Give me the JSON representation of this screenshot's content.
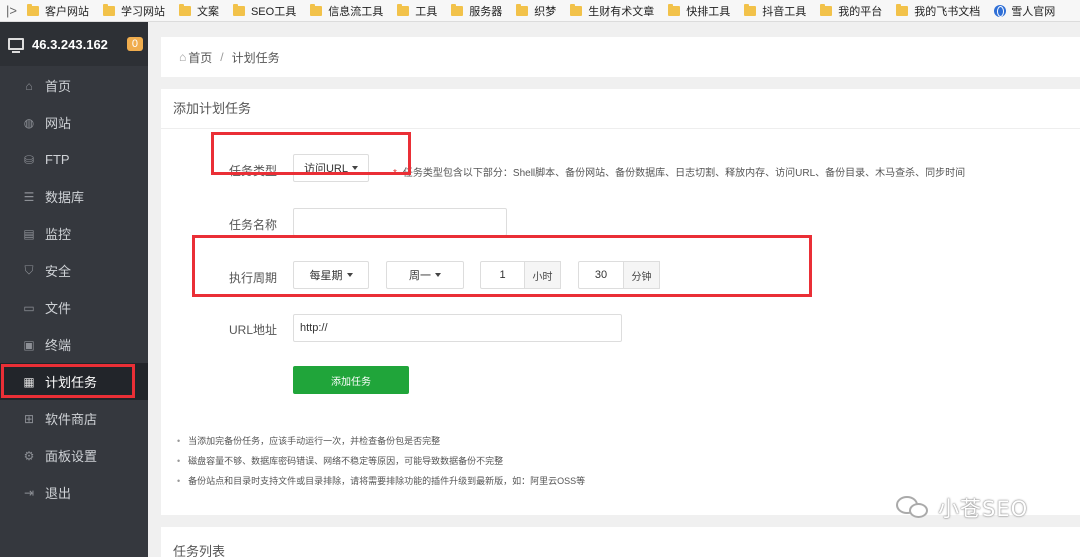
{
  "bookmarks": [
    {
      "label": "客户网站",
      "icon": "folder-icon"
    },
    {
      "label": "学习网站",
      "icon": "folder-icon"
    },
    {
      "label": "文案",
      "icon": "folder-icon"
    },
    {
      "label": "SEO工具",
      "icon": "folder-icon"
    },
    {
      "label": "信息流工具",
      "icon": "folder-icon"
    },
    {
      "label": "工具",
      "icon": "folder-icon"
    },
    {
      "label": "服务器",
      "icon": "folder-icon"
    },
    {
      "label": "织梦",
      "icon": "folder-icon"
    },
    {
      "label": "生财有术文章",
      "icon": "folder-icon"
    },
    {
      "label": "快排工具",
      "icon": "folder-icon"
    },
    {
      "label": "抖音工具",
      "icon": "folder-icon"
    },
    {
      "label": "我的平台",
      "icon": "folder-icon"
    },
    {
      "label": "我的飞书文档",
      "icon": "folder-icon"
    },
    {
      "label": "雪人官网",
      "icon": "globe-icon"
    }
  ],
  "sidebar": {
    "ip": "46.3.243.162",
    "badge": "0",
    "items": [
      {
        "label": "首页",
        "icon": "home-icon",
        "glyph": "⌂"
      },
      {
        "label": "网站",
        "icon": "globe-icon",
        "glyph": "◍"
      },
      {
        "label": "FTP",
        "icon": "ftp-icon",
        "glyph": "⛁"
      },
      {
        "label": "数据库",
        "icon": "database-icon",
        "glyph": "☰"
      },
      {
        "label": "监控",
        "icon": "monitor-icon",
        "glyph": "▤"
      },
      {
        "label": "安全",
        "icon": "shield-icon",
        "glyph": "⛉"
      },
      {
        "label": "文件",
        "icon": "folder-icon",
        "glyph": "▭"
      },
      {
        "label": "终端",
        "icon": "terminal-icon",
        "glyph": "▣"
      },
      {
        "label": "计划任务",
        "icon": "calendar-icon",
        "glyph": "▦"
      },
      {
        "label": "软件商店",
        "icon": "apps-icon",
        "glyph": "⊞"
      },
      {
        "label": "面板设置",
        "icon": "gear-icon",
        "glyph": "⚙"
      },
      {
        "label": "退出",
        "icon": "logout-icon",
        "glyph": "⇥"
      }
    ]
  },
  "breadcrumb": {
    "home": "首页",
    "separator": "/",
    "current": "计划任务"
  },
  "form": {
    "title": "添加计划任务",
    "task_type_label": "任务类型",
    "task_type_value": "访问URL",
    "task_type_hint": "任务类型包含以下部分：Shell脚本、备份网站、备份数据库、日志切割、释放内存、访问URL、备份目录、木马查杀、同步时间",
    "task_name_label": "任务名称",
    "task_name_value": "",
    "period_label": "执行周期",
    "period_value": "每星期",
    "weekday_value": "周一",
    "hour_value": "1",
    "hour_unit": "小时",
    "minute_value": "30",
    "minute_unit": "分钟",
    "url_label": "URL地址",
    "url_value": "http://",
    "submit_label": "添加任务"
  },
  "notes": [
    "当添加完备份任务，应该手动运行一次，并检查备份包是否完整",
    "磁盘容量不够、数据库密码错误、网络不稳定等原因，可能导致数据备份不完整",
    "备份站点和目录时支持文件或目录排除，请将需要排除功能的插件升级到最新版，如：阿里云OSS等"
  ],
  "list": {
    "title": "任务列表"
  },
  "watermark": "小苍SEO"
}
